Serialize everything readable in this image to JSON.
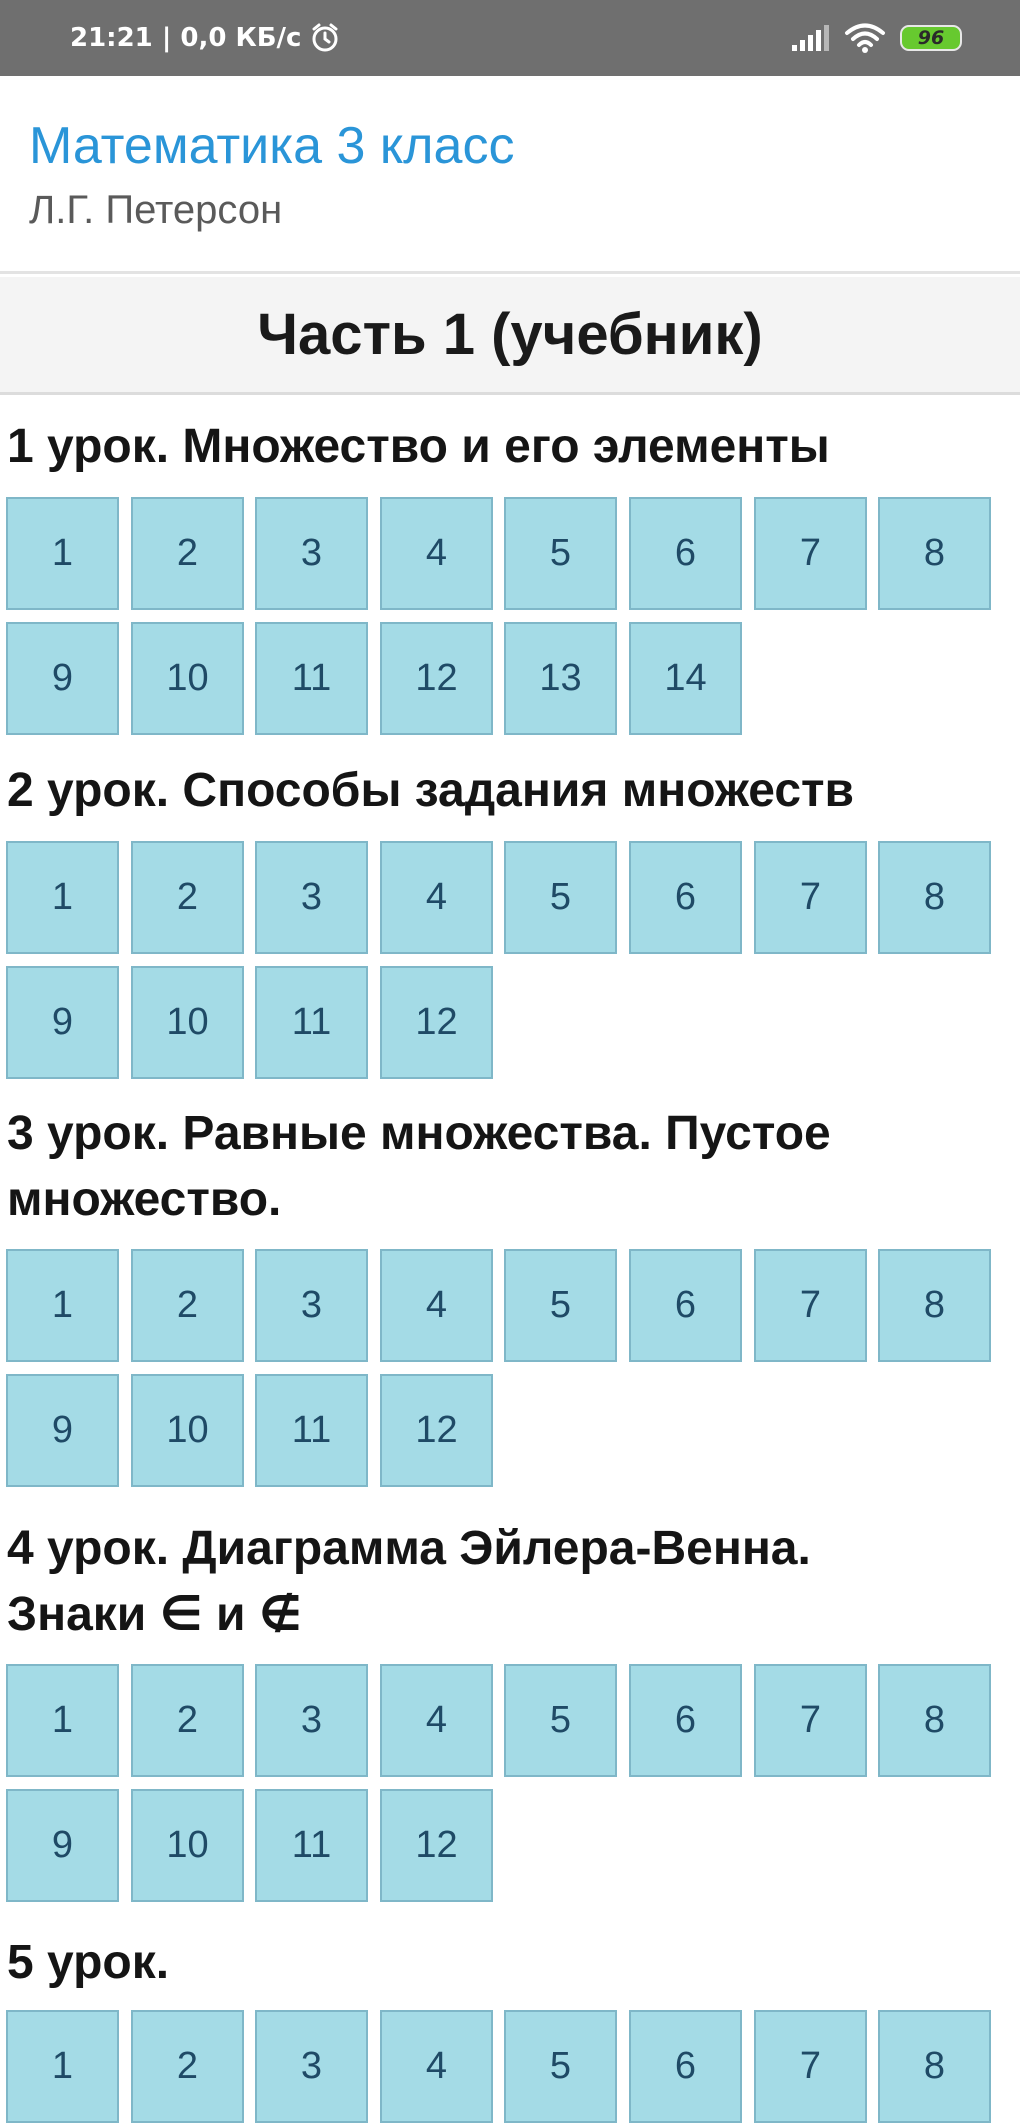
{
  "status_bar": {
    "time": "21:21",
    "speed": "0,0 КБ/с",
    "battery": "96",
    "icons": [
      "alarm-icon",
      "signal-icon",
      "wifi-icon",
      "battery-icon"
    ]
  },
  "header": {
    "title": "Математика 3 класс",
    "subtitle": "Л.Г. Петерсон"
  },
  "part": {
    "title": "Часть 1 (учебник)"
  },
  "colors": {
    "accent": "#2a95d8",
    "tile_bg": "#a4dbe6",
    "tile_border": "#7fb7c8",
    "tile_text": "#1f4a66"
  },
  "lessons": [
    {
      "title_lines": [
        "1 урок. Множество и его элементы"
      ],
      "tasks": [
        "1",
        "2",
        "3",
        "4",
        "5",
        "6",
        "7",
        "8",
        "9",
        "10",
        "11",
        "12",
        "13",
        "14"
      ]
    },
    {
      "title_lines": [
        "2 урок. Способы задания множеств"
      ],
      "tasks": [
        "1",
        "2",
        "3",
        "4",
        "5",
        "6",
        "7",
        "8",
        "9",
        "10",
        "11",
        "12"
      ]
    },
    {
      "title_lines": [
        "3 урок. Равные множества. Пустое",
        "множество."
      ],
      "tasks": [
        "1",
        "2",
        "3",
        "4",
        "5",
        "6",
        "7",
        "8",
        "9",
        "10",
        "11",
        "12"
      ]
    },
    {
      "title_lines": [
        "4 урок. Диаграмма Эйлера-Венна.",
        "Знаки ∈ и ∉"
      ],
      "tasks": [
        "1",
        "2",
        "3",
        "4",
        "5",
        "6",
        "7",
        "8",
        "9",
        "10",
        "11",
        "12"
      ]
    },
    {
      "title_lines": [
        "5 урок."
      ],
      "tasks": [
        "1",
        "2",
        "3",
        "4",
        "5",
        "6",
        "7",
        "8"
      ]
    }
  ]
}
